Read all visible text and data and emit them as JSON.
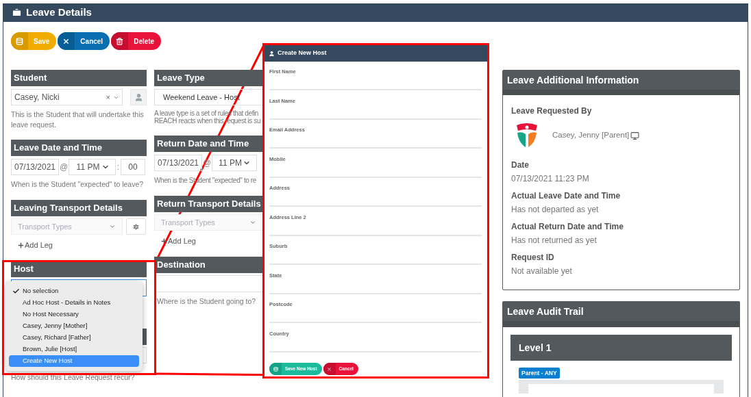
{
  "page": {
    "title": "Leave Details"
  },
  "toolbar": [
    {
      "label": "Save",
      "kind": "save"
    },
    {
      "label": "Cancel",
      "kind": "cancel"
    },
    {
      "label": "Delete",
      "kind": "delete"
    }
  ],
  "student": {
    "header": "Student",
    "value": "Casey, Nicki",
    "clear": "×",
    "help": "This is the Student that will undertake this leave request."
  },
  "leave_type": {
    "header": "Leave Type",
    "value": "Weekend Leave - Host",
    "help_lines": [
      "A leave type is a set of rules that defin",
      "REACH reacts when this request is su"
    ]
  },
  "leave_date": {
    "header": "Leave Date and Time",
    "date": "07/13/2021",
    "at": "@",
    "hour": "11 PM",
    "colon": ":",
    "minute": "00",
    "help": "When is the Student \"expected\" to leave?"
  },
  "return_date": {
    "header": "Return Date and Time",
    "date": "07/13/2021",
    "at": "@",
    "hour": "11 PM",
    "help": "When is the Student \"expected\" to re"
  },
  "leaving_transport": {
    "header": "Leaving Transport Details",
    "placeholder": "Transport Types",
    "add_leg": "Add Leg"
  },
  "return_transport": {
    "header": "Return Transport Details",
    "placeholder": "Transport Types",
    "add_leg": "Add Leg"
  },
  "host": {
    "header": "Host",
    "options": [
      {
        "label": "No selection",
        "selected": true,
        "highlighted": false
      },
      {
        "label": "Ad Hoc Host - Details in Notes",
        "selected": false,
        "highlighted": false
      },
      {
        "label": "No Host Necessary",
        "selected": false,
        "highlighted": false
      },
      {
        "label": "Casey, Jenny [Mother]",
        "selected": false,
        "highlighted": false
      },
      {
        "label": "Casey, Richard [Father]",
        "selected": false,
        "highlighted": false
      },
      {
        "label": "Brown, Julie [Host]",
        "selected": false,
        "highlighted": false
      },
      {
        "label": "Create New Host",
        "selected": false,
        "highlighted": true
      }
    ]
  },
  "recurrence": {
    "help": "How should this Leave Request recur?"
  },
  "destination": {
    "header": "Destination",
    "help": "Where is the Student going to?"
  },
  "create_host_modal": {
    "title": "Create New Host",
    "fields": [
      "First Name",
      "Last Name",
      "Email Address",
      "Mobile",
      "Address",
      "Address Line 2",
      "Suburb",
      "State",
      "Postcode",
      "Country"
    ],
    "buttons": [
      {
        "label": "Save New Host",
        "kind": "save"
      },
      {
        "label": "Cancel",
        "kind": "cancel"
      }
    ]
  },
  "additional_info": {
    "title": "Leave Additional Information",
    "requested_by_label": "Leave Requested By",
    "requester": "Casey, Jenny [Parent]",
    "items": [
      {
        "label": "Date",
        "value": "07/13/2021 11:23 PM"
      },
      {
        "label": "Actual Leave Date and Time",
        "value": "Has not departed as yet"
      },
      {
        "label": "Actual Return Date and Time",
        "value": "Has not returned as yet"
      },
      {
        "label": "Request ID",
        "value": "Not available yet"
      }
    ]
  },
  "audit_trail": {
    "title": "Leave Audit Trail",
    "level": "Level 1",
    "badge": "Parent - ANY"
  }
}
